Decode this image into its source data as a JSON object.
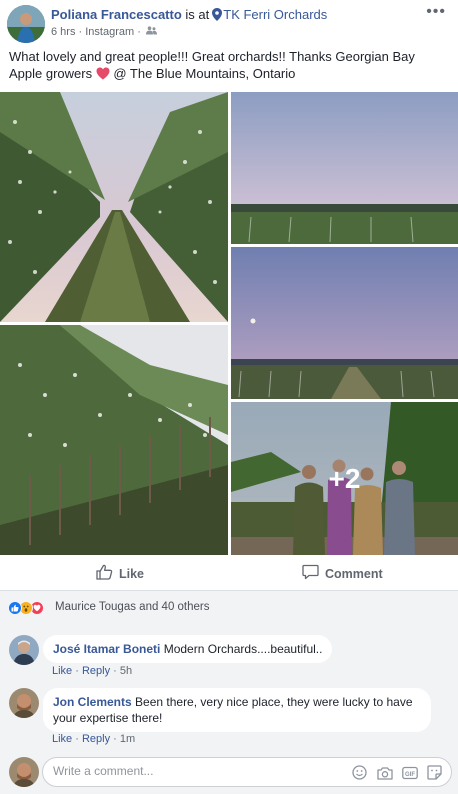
{
  "post": {
    "author": "Poliana Francescatto",
    "is_at": " is at",
    "location": "TK Ferri Orchards",
    "time": "6 hrs",
    "sep1": " · ",
    "source": "Instagram",
    "sep2": " · ",
    "more": "•••",
    "text_part1": "What lovely and great people!!! Great orchards!! Thanks Georgian Bay Apple growers ",
    "text_part2": " @ The Blue Mountains, Ontario",
    "more_photos": "+2"
  },
  "actions": {
    "like": "Like",
    "comment": "Comment"
  },
  "reactions": {
    "summary": "Maurice Tougas and 40 others"
  },
  "comments": [
    {
      "name": "José Itamar Boneti",
      "text": " Modern Orchards....beautiful..",
      "like": "Like",
      "reply": "Reply",
      "time": "5h"
    },
    {
      "name": "Jon Clements",
      "text": " Been there, very nice place, they were lucky to have your expertise there!",
      "like": "Like",
      "reply": "Reply",
      "time": "1m"
    }
  ],
  "composer": {
    "placeholder": "Write a comment..."
  },
  "colors": {
    "link": "#385898",
    "meta": "#616770",
    "like_blue": "#1877f2",
    "love_red": "#f33e58",
    "wow_yellow": "#f7b125"
  }
}
